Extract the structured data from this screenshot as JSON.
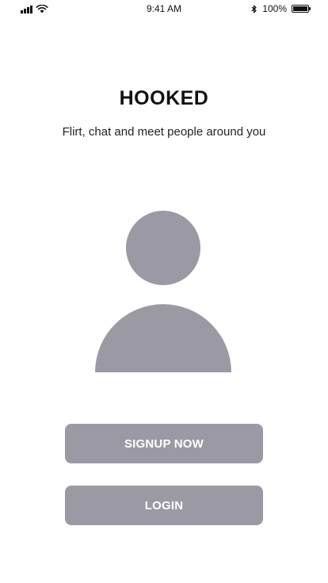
{
  "status_bar": {
    "time": "9:41 AM",
    "battery_text": "100%",
    "battery_level": 1.0,
    "icons": [
      "signal-icon",
      "wifi-icon",
      "bluetooth-icon",
      "battery-icon"
    ]
  },
  "app": {
    "title": "HOOKED",
    "tagline": "Flirt, chat and meet people around you"
  },
  "avatar": {
    "icon": "user-avatar-icon",
    "color": "#9b9aa4"
  },
  "buttons": {
    "signup_label": "SIGNUP NOW",
    "login_label": "LOGIN",
    "color": "#9b9aa4",
    "text_color": "#ffffff"
  }
}
